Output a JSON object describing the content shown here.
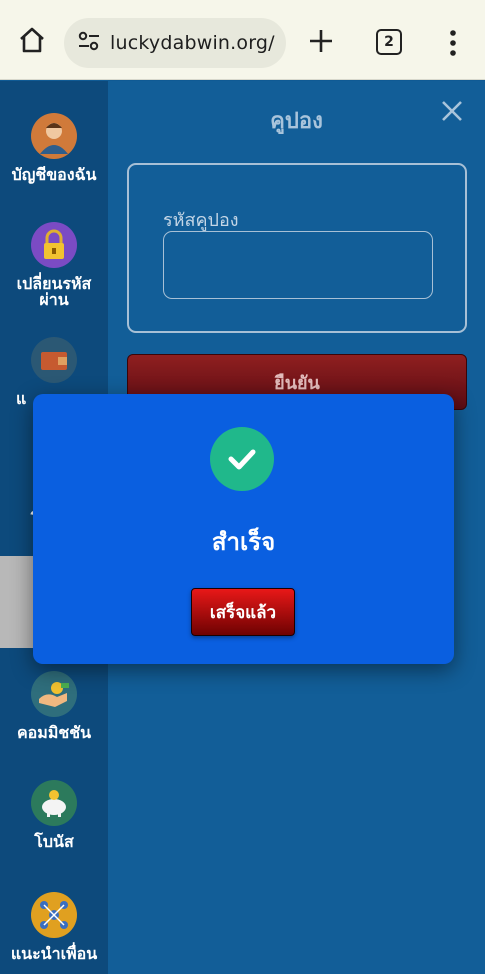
{
  "browser": {
    "url": "luckydabwin.org/",
    "tab_count": "2"
  },
  "sidebar": {
    "items": [
      {
        "label": "บัญชีของฉัน",
        "icon": "account-avatar-icon"
      },
      {
        "label": "เปลี่ยนรหัสผ่าน",
        "icon": "lock-icon"
      },
      {
        "label": "แ",
        "icon": "wallet-icon"
      },
      {
        "label": "ร",
        "icon": "history-icon"
      },
      {
        "label": "",
        "icon": "coupon-icon"
      },
      {
        "label": "คอมมิชชัน",
        "icon": "commission-icon"
      },
      {
        "label": "โบนัส",
        "icon": "piggy-bank-icon"
      },
      {
        "label": "แนะนำเพื่อน",
        "icon": "referral-network-icon"
      }
    ]
  },
  "main": {
    "title": "คูปอง",
    "coupon_label": "รหัสคูปอง",
    "coupon_value": "",
    "confirm_label": "ยืนยัน"
  },
  "modal": {
    "title": "สำเร็จ",
    "done_label": "เสร็จแล้ว"
  },
  "colors": {
    "sidebar": "#0d4a7c",
    "main": "#125e98",
    "modal": "#0a5fe0",
    "success": "#20b88b",
    "button_red": "#c00000"
  }
}
